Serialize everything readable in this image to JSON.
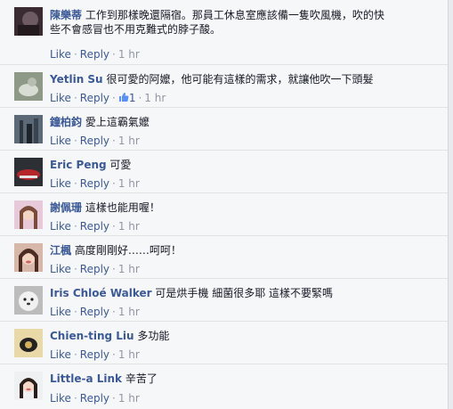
{
  "comments": [
    {
      "author": "陳樂蒂",
      "text": "工作到那樣晚還隔宿。那員工休息室應該備一隻吹風機，吹的快",
      "text2": "些不會感冒也不用克難式的脖子酸。",
      "like": "Like",
      "reply": "Reply",
      "time": "1 hr",
      "likes": ""
    },
    {
      "author": "Yetlin Su",
      "text": "很可愛的阿嬤，他可能有這樣的需求，就讓他吹一下頭髮",
      "like": "Like",
      "reply": "Reply",
      "time": "1 hr",
      "likes": "1"
    },
    {
      "author": "鐘柏鈞",
      "text": "愛上這霸氣嬤",
      "like": "Like",
      "reply": "Reply",
      "time": "1 hr",
      "likes": ""
    },
    {
      "author": "Eric Peng",
      "text": "可愛",
      "like": "Like",
      "reply": "Reply",
      "time": "1 hr",
      "likes": ""
    },
    {
      "author": "謝佩珊",
      "text": "這樣也能用喔！",
      "like": "Like",
      "reply": "Reply",
      "time": "1 hr",
      "likes": ""
    },
    {
      "author": "江楓",
      "text": "高度剛剛好……呵呵！",
      "like": "Like",
      "reply": "Reply",
      "time": "1 hr",
      "likes": ""
    },
    {
      "author": "Iris Chloé Walker",
      "text": "可是烘手機 細菌很多耶 這樣不要緊嗎",
      "like": "Like",
      "reply": "Reply",
      "time": "1 hr",
      "likes": ""
    },
    {
      "author": "Chien-ting Liu",
      "text": "多功能",
      "like": "Like",
      "reply": "Reply",
      "time": "1 hr",
      "likes": ""
    },
    {
      "author": "Little-a Link",
      "text": "辛苦了",
      "like": "Like",
      "reply": "Reply",
      "time": "1 hr",
      "likes": ""
    }
  ],
  "colors": {
    "link": "#3b5998",
    "meta": "#9197a3",
    "background": "#f6f7f9"
  },
  "icons": {
    "like_count": "thumbs-up-icon"
  }
}
